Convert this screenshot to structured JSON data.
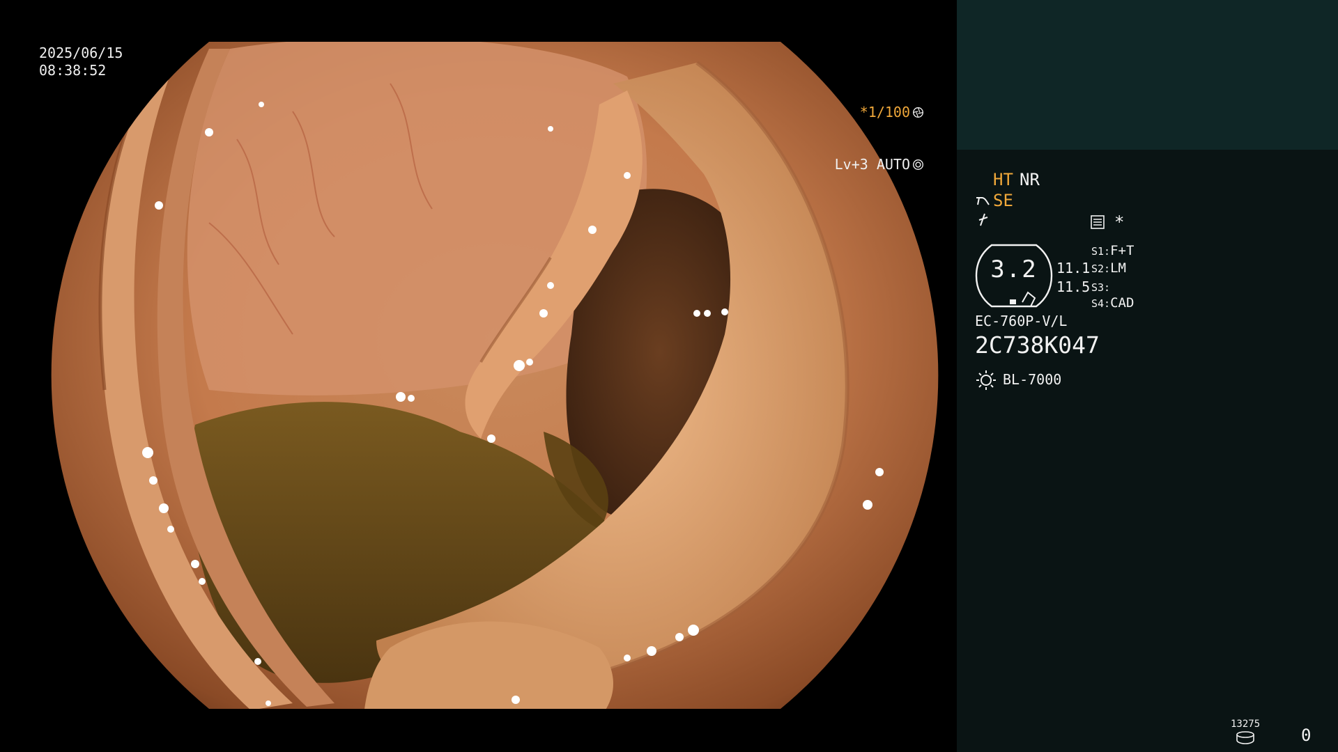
{
  "osd": {
    "date": "2025/06/15",
    "time": "08:38:52",
    "shutter": "*1/100",
    "shutter_icon": "aperture-icon",
    "enhancement": "Lv+3 AUTO",
    "enhancement_icon": "iris-icon"
  },
  "panel": {
    "ht_label": "HT",
    "nr_label": "NR",
    "se_label": "SE",
    "se_icon": "scope-bend-icon",
    "flash_icon": "flash-icon",
    "list_icon": "list-icon",
    "asterisk": "*",
    "level_value": "3.2",
    "side_value_1": "11.1",
    "side_value_2": "11.5",
    "slots": [
      {
        "key": "S1:",
        "value": "F+T"
      },
      {
        "key": "S2:",
        "value": "LM"
      },
      {
        "key": "S3:",
        "value": ""
      },
      {
        "key": "S4:",
        "value": "CAD"
      }
    ],
    "scope_model": "EC-760P-V/L",
    "scope_serial": "2C738K047",
    "light_icon": "sun-icon",
    "light_source": "BL-7000",
    "storage_count": "13275",
    "storage_icon": "disk-icon",
    "frame_count": "0"
  },
  "colors": {
    "panel_bg": "#0a1414",
    "panel_top_bg": "#0f2626",
    "accent_amber": "#f0a83a",
    "text": "#f2f2f2"
  }
}
